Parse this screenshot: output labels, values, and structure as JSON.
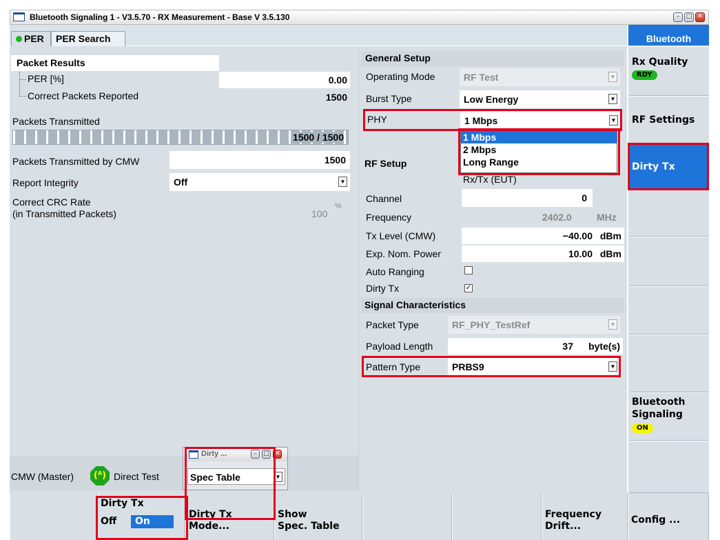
{
  "window": {
    "title": "Bluetooth Signaling 1 - V3.5.70 - RX Measurement - Base V 3.5.130"
  },
  "tabs": [
    {
      "label": "PER"
    },
    {
      "label": "PER Search"
    }
  ],
  "packet_results": {
    "header": "Packet Results",
    "per_label": "PER [%]",
    "per_value": "0.00",
    "correct_label": "Correct Packets Reported",
    "correct_value": "1500"
  },
  "packets_transmitted": {
    "label": "Packets Transmitted",
    "progress_text": "1500 / 1500",
    "progress_fraction": 1.0
  },
  "cmw_packets": {
    "label": "Packets Transmitted by CMW",
    "value": "1500"
  },
  "report_integrity": {
    "label": "Report Integrity",
    "value": "Off"
  },
  "crc_rate": {
    "label_line1": "Correct CRC Rate",
    "label_line2": "(in Transmitted Packets)",
    "value": "100",
    "unit": "%"
  },
  "general_setup": {
    "header": "General Setup",
    "operating_mode": {
      "label": "Operating Mode",
      "value": "RF Test"
    },
    "burst_type": {
      "label": "Burst Type",
      "value": "Low Energy"
    },
    "phy": {
      "label": "PHY",
      "value": "1 Mbps",
      "options": [
        "1 Mbps",
        "2 Mbps",
        "Long Range"
      ]
    }
  },
  "rf_setup": {
    "header": "RF Setup",
    "rxtx": "Rx/Tx (EUT)",
    "channel": {
      "label": "Channel",
      "value": "0"
    },
    "frequency": {
      "label": "Frequency",
      "value": "2402.0",
      "unit": "MHz"
    },
    "tx_level": {
      "label": "Tx Level (CMW)",
      "value": "−40.00",
      "unit": "dBm"
    },
    "exp_power": {
      "label": "Exp. Nom. Power",
      "value": "10.00",
      "unit": "dBm"
    },
    "auto_ranging": {
      "label": "Auto Ranging",
      "checked": false
    },
    "dirty_tx": {
      "label": "Dirty Tx",
      "checked": true
    }
  },
  "signal_characteristics": {
    "header": "Signal Characteristics",
    "packet_type": {
      "label": "Packet Type",
      "value": "RF_PHY_TestRef"
    },
    "payload_length": {
      "label": "Payload Length",
      "value": "37",
      "unit": "byte(s)"
    },
    "pattern_type": {
      "label": "Pattern Type",
      "value": "PRBS9"
    }
  },
  "status_bar": {
    "cmw_label": "CMW (Master)",
    "mode_label": "Direct Test"
  },
  "popup": {
    "title": "Dirty ...",
    "value": "Spec Table"
  },
  "sidebar": {
    "header": "Bluetooth",
    "rx_quality": {
      "label": "Rx Quality",
      "badge": "RDY"
    },
    "rf_settings": {
      "label": "RF Settings"
    },
    "dirty_tx": {
      "label": "Dirty Tx"
    },
    "bt_signaling": {
      "line1": "Bluetooth",
      "line2": "Signaling",
      "badge": "ON"
    }
  },
  "bottom": {
    "dirty_tx": {
      "label": "Dirty Tx",
      "off": "Off",
      "on": "On"
    },
    "dirty_tx_mode": {
      "line1": "Dirty Tx",
      "line2": "Mode..."
    },
    "show_spec": {
      "line1": "Show",
      "line2": "Spec. Table"
    },
    "freq_drift": {
      "line1": "Frequency",
      "line2": "Drift..."
    },
    "config": {
      "label": "Config ..."
    }
  },
  "colors": {
    "accent": "#1e74d8",
    "highlight": "#e0001c",
    "panel": "#d9e0e5",
    "badge_green": "#1fb51f",
    "badge_yellow": "#f5f500"
  }
}
